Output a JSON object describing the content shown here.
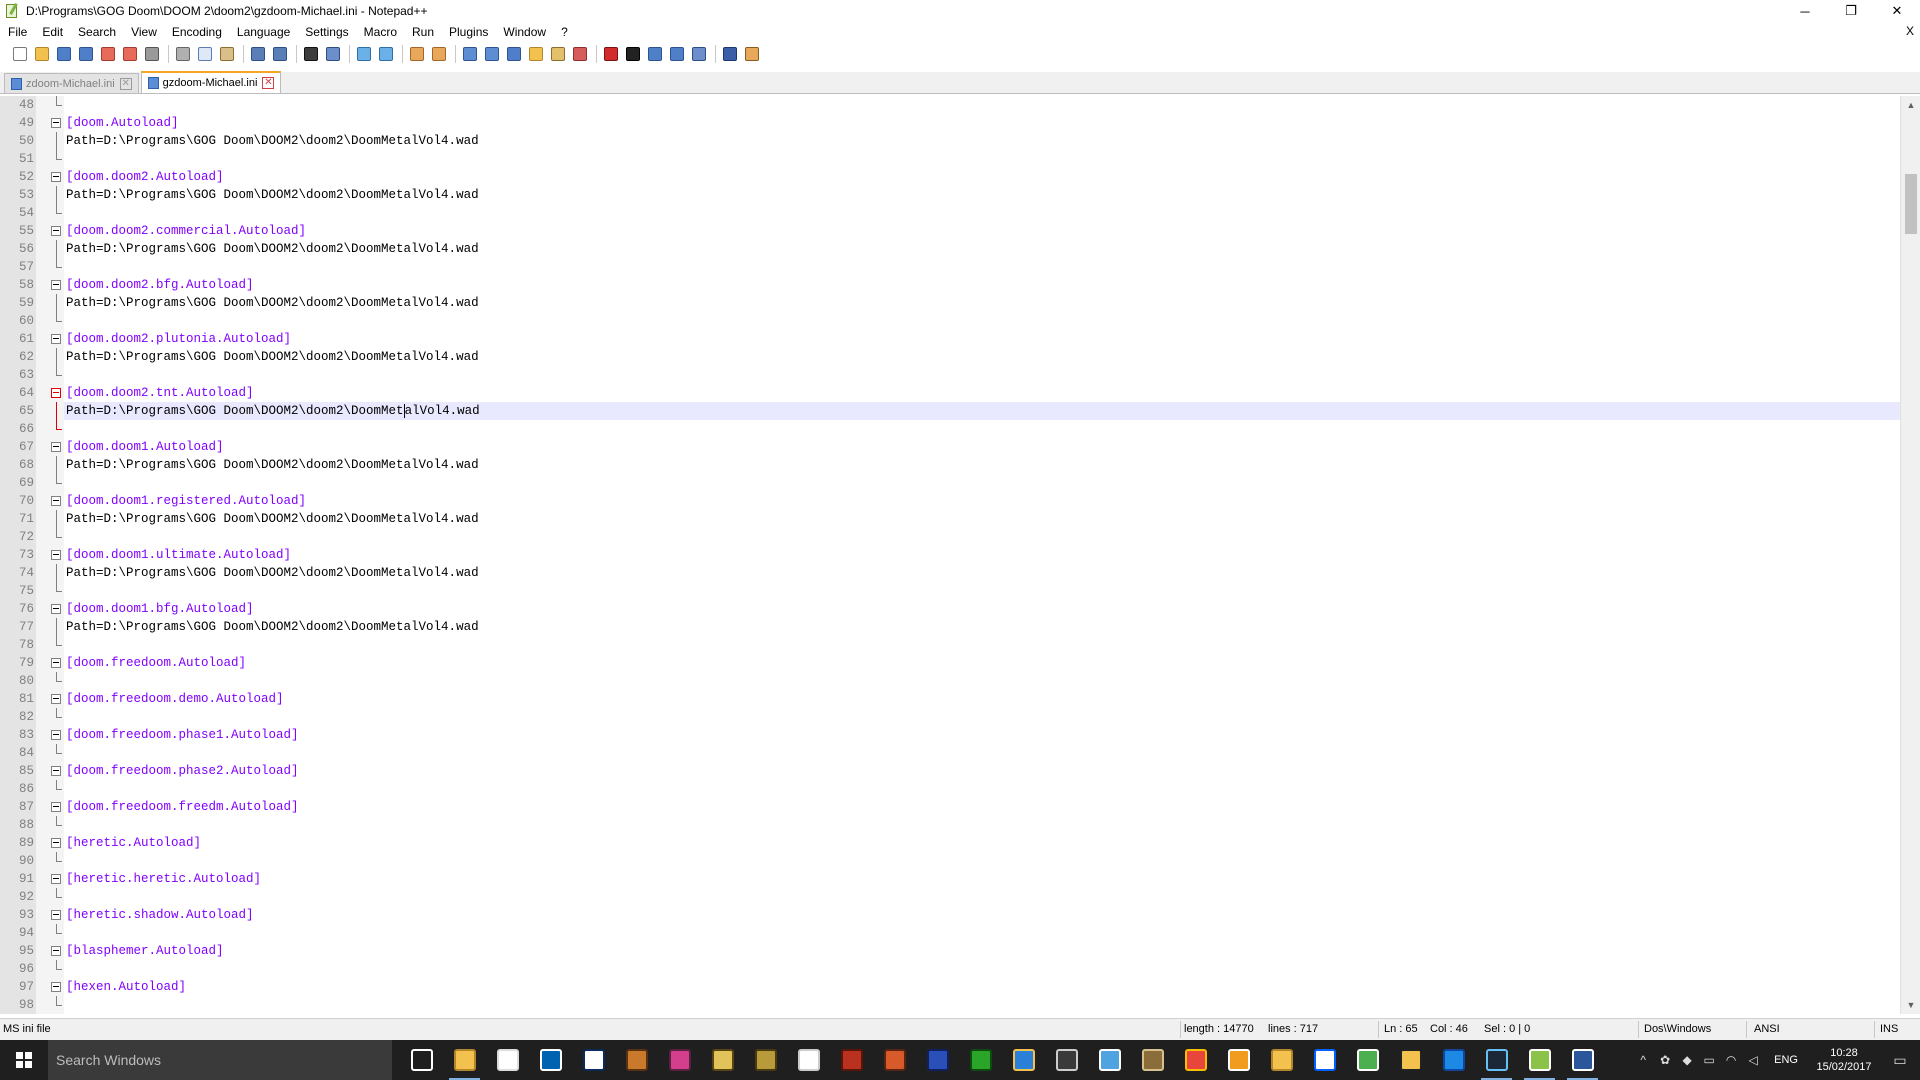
{
  "window": {
    "title": "D:\\Programs\\GOG Doom\\DOOM 2\\doom2\\gzdoom-Michael.ini - Notepad++",
    "minimize_glyph": "─",
    "restore_glyph": "❐",
    "close_glyph": "✕"
  },
  "menu": {
    "items": [
      "File",
      "Edit",
      "Search",
      "View",
      "Encoding",
      "Language",
      "Settings",
      "Macro",
      "Run",
      "Plugins",
      "Window",
      "?"
    ],
    "doc_close": "X"
  },
  "toolbar": {
    "icons": [
      {
        "name": "new-file-icon",
        "color": "#ffffff",
        "border": "#7a7a7a"
      },
      {
        "name": "open-file-icon",
        "color": "#f2c14e",
        "border": "#b3862a"
      },
      {
        "name": "save-icon",
        "color": "#4f7fc9",
        "border": "#2d5491"
      },
      {
        "name": "save-all-icon",
        "color": "#4f7fc9",
        "border": "#2d5491"
      },
      {
        "name": "close-icon",
        "color": "#e86a5a",
        "border": "#a33c2f"
      },
      {
        "name": "close-all-icon",
        "color": "#e86a5a",
        "border": "#a33c2f"
      },
      {
        "name": "print-icon",
        "color": "#9a9a9a",
        "border": "#555555"
      },
      {
        "sep": true
      },
      {
        "name": "cut-icon",
        "color": "#b0b0b0",
        "border": "#666666"
      },
      {
        "name": "copy-icon",
        "color": "#dfe8f5",
        "border": "#5c7db3"
      },
      {
        "name": "paste-icon",
        "color": "#d9c08a",
        "border": "#8c6d2f"
      },
      {
        "sep": true
      },
      {
        "name": "undo-icon",
        "color": "#5a7fb8",
        "border": "#2d4f86"
      },
      {
        "name": "redo-icon",
        "color": "#5a7fb8",
        "border": "#2d4f86"
      },
      {
        "sep": true
      },
      {
        "name": "find-icon",
        "color": "#3c3c3c",
        "border": "#111111"
      },
      {
        "name": "replace-icon",
        "color": "#6c8fcb",
        "border": "#2d4f86"
      },
      {
        "sep": true
      },
      {
        "name": "zoom-in-icon",
        "color": "#6bb0e6",
        "border": "#2f6ea8"
      },
      {
        "name": "zoom-out-icon",
        "color": "#6bb0e6",
        "border": "#2f6ea8"
      },
      {
        "sep": true
      },
      {
        "name": "sync-vertical-icon",
        "color": "#e7a85a",
        "border": "#a3652a"
      },
      {
        "name": "sync-horizontal-icon",
        "color": "#e7a85a",
        "border": "#a3652a"
      },
      {
        "sep": true
      },
      {
        "name": "word-wrap-icon",
        "color": "#5d8ed4",
        "border": "#2d5491"
      },
      {
        "name": "show-all-characters-icon",
        "color": "#5d8ed4",
        "border": "#2d5491"
      },
      {
        "name": "indent-guide-icon",
        "color": "#4f7fc9",
        "border": "#2d5491"
      },
      {
        "name": "document-map-icon",
        "color": "#f2c14e",
        "border": "#b3862a"
      },
      {
        "name": "function-list-icon",
        "color": "#e3c06a",
        "border": "#8c6d2f"
      },
      {
        "name": "folder-as-workspace-icon",
        "color": "#d65b5b",
        "border": "#8f2c2c"
      },
      {
        "sep": true
      },
      {
        "name": "record-macro-icon",
        "color": "#d22b2b",
        "border": "#7a1414"
      },
      {
        "name": "stop-recording-icon",
        "color": "#222222",
        "border": "#000000"
      },
      {
        "name": "playback-macro-icon",
        "color": "#4f7fc9",
        "border": "#2d5491"
      },
      {
        "name": "run-macro-multiple-icon",
        "color": "#4f7fc9",
        "border": "#2d5491"
      },
      {
        "name": "save-macro-icon",
        "color": "#6c8fcb",
        "border": "#2d4f86"
      },
      {
        "sep": true
      },
      {
        "name": "spell-check-icon",
        "color": "#3a5ea8",
        "border": "#1c3670"
      },
      {
        "name": "plugin-icon",
        "color": "#e7a85a",
        "border": "#8a5a1f"
      }
    ]
  },
  "tabs": [
    {
      "label": "zdoom-Michael.ini",
      "active": false
    },
    {
      "label": "gzdoom-Michael.ini",
      "active": true
    }
  ],
  "editor": {
    "current_line": 65,
    "caret_column": 46,
    "lines": [
      {
        "n": 48,
        "text": "",
        "type": "blank",
        "fold": "end"
      },
      {
        "n": 49,
        "text": "[doom.Autoload]",
        "type": "section",
        "fold": "start"
      },
      {
        "n": 50,
        "text": "Path=D:\\Programs\\GOG Doom\\DOOM2\\doom2\\DoomMetalVol4.wad",
        "type": "kv",
        "fold": "line"
      },
      {
        "n": 51,
        "text": "",
        "type": "blank",
        "fold": "end"
      },
      {
        "n": 52,
        "text": "[doom.doom2.Autoload]",
        "type": "section",
        "fold": "start"
      },
      {
        "n": 53,
        "text": "Path=D:\\Programs\\GOG Doom\\DOOM2\\doom2\\DoomMetalVol4.wad",
        "type": "kv",
        "fold": "line"
      },
      {
        "n": 54,
        "text": "",
        "type": "blank",
        "fold": "end"
      },
      {
        "n": 55,
        "text": "[doom.doom2.commercial.Autoload]",
        "type": "section",
        "fold": "start"
      },
      {
        "n": 56,
        "text": "Path=D:\\Programs\\GOG Doom\\DOOM2\\doom2\\DoomMetalVol4.wad",
        "type": "kv",
        "fold": "line"
      },
      {
        "n": 57,
        "text": "",
        "type": "blank",
        "fold": "end"
      },
      {
        "n": 58,
        "text": "[doom.doom2.bfg.Autoload]",
        "type": "section",
        "fold": "start"
      },
      {
        "n": 59,
        "text": "Path=D:\\Programs\\GOG Doom\\DOOM2\\doom2\\DoomMetalVol4.wad",
        "type": "kv",
        "fold": "line"
      },
      {
        "n": 60,
        "text": "",
        "type": "blank",
        "fold": "end"
      },
      {
        "n": 61,
        "text": "[doom.doom2.plutonia.Autoload]",
        "type": "section",
        "fold": "start"
      },
      {
        "n": 62,
        "text": "Path=D:\\Programs\\GOG Doom\\DOOM2\\doom2\\DoomMetalVol4.wad",
        "type": "kv",
        "fold": "line"
      },
      {
        "n": 63,
        "text": "",
        "type": "blank",
        "fold": "end"
      },
      {
        "n": 64,
        "text": "[doom.doom2.tnt.Autoload]",
        "type": "section",
        "fold": "start",
        "active": true
      },
      {
        "n": 65,
        "text": "Path=D:\\Programs\\GOG Doom\\DOOM2\\doom2\\DoomMetalVol4.wad",
        "type": "kv",
        "fold": "line",
        "active": true
      },
      {
        "n": 66,
        "text": "",
        "type": "blank",
        "fold": "end",
        "active": true
      },
      {
        "n": 67,
        "text": "[doom.doom1.Autoload]",
        "type": "section",
        "fold": "start"
      },
      {
        "n": 68,
        "text": "Path=D:\\Programs\\GOG Doom\\DOOM2\\doom2\\DoomMetalVol4.wad",
        "type": "kv",
        "fold": "line"
      },
      {
        "n": 69,
        "text": "",
        "type": "blank",
        "fold": "end"
      },
      {
        "n": 70,
        "text": "[doom.doom1.registered.Autoload]",
        "type": "section",
        "fold": "start"
      },
      {
        "n": 71,
        "text": "Path=D:\\Programs\\GOG Doom\\DOOM2\\doom2\\DoomMetalVol4.wad",
        "type": "kv",
        "fold": "line"
      },
      {
        "n": 72,
        "text": "",
        "type": "blank",
        "fold": "end"
      },
      {
        "n": 73,
        "text": "[doom.doom1.ultimate.Autoload]",
        "type": "section",
        "fold": "start"
      },
      {
        "n": 74,
        "text": "Path=D:\\Programs\\GOG Doom\\DOOM2\\doom2\\DoomMetalVol4.wad",
        "type": "kv",
        "fold": "line"
      },
      {
        "n": 75,
        "text": "",
        "type": "blank",
        "fold": "end"
      },
      {
        "n": 76,
        "text": "[doom.doom1.bfg.Autoload]",
        "type": "section",
        "fold": "start"
      },
      {
        "n": 77,
        "text": "Path=D:\\Programs\\GOG Doom\\DOOM2\\doom2\\DoomMetalVol4.wad",
        "type": "kv",
        "fold": "line"
      },
      {
        "n": 78,
        "text": "",
        "type": "blank",
        "fold": "end"
      },
      {
        "n": 79,
        "text": "[doom.freedoom.Autoload]",
        "type": "section",
        "fold": "start"
      },
      {
        "n": 80,
        "text": "",
        "type": "blank",
        "fold": "end"
      },
      {
        "n": 81,
        "text": "[doom.freedoom.demo.Autoload]",
        "type": "section",
        "fold": "start"
      },
      {
        "n": 82,
        "text": "",
        "type": "blank",
        "fold": "end"
      },
      {
        "n": 83,
        "text": "[doom.freedoom.phase1.Autoload]",
        "type": "section",
        "fold": "start"
      },
      {
        "n": 84,
        "text": "",
        "type": "blank",
        "fold": "end"
      },
      {
        "n": 85,
        "text": "[doom.freedoom.phase2.Autoload]",
        "type": "section",
        "fold": "start"
      },
      {
        "n": 86,
        "text": "",
        "type": "blank",
        "fold": "end"
      },
      {
        "n": 87,
        "text": "[doom.freedoom.freedm.Autoload]",
        "type": "section",
        "fold": "start"
      },
      {
        "n": 88,
        "text": "",
        "type": "blank",
        "fold": "end"
      },
      {
        "n": 89,
        "text": "[heretic.Autoload]",
        "type": "section",
        "fold": "start"
      },
      {
        "n": 90,
        "text": "",
        "type": "blank",
        "fold": "end"
      },
      {
        "n": 91,
        "text": "[heretic.heretic.Autoload]",
        "type": "section",
        "fold": "start"
      },
      {
        "n": 92,
        "text": "",
        "type": "blank",
        "fold": "end"
      },
      {
        "n": 93,
        "text": "[heretic.shadow.Autoload]",
        "type": "section",
        "fold": "start"
      },
      {
        "n": 94,
        "text": "",
        "type": "blank",
        "fold": "end"
      },
      {
        "n": 95,
        "text": "[blasphemer.Autoload]",
        "type": "section",
        "fold": "start"
      },
      {
        "n": 96,
        "text": "",
        "type": "blank",
        "fold": "end"
      },
      {
        "n": 97,
        "text": "[hexen.Autoload]",
        "type": "section",
        "fold": "start"
      },
      {
        "n": 98,
        "text": "",
        "type": "blank",
        "fold": "end"
      }
    ]
  },
  "scrollbar": {
    "up_glyph": "▲",
    "down_glyph": "▼"
  },
  "status": {
    "file_type": "MS ini file",
    "length": "length : 14770",
    "lines": "lines : 717",
    "ln": "Ln : 65",
    "col": "Col : 46",
    "sel": "Sel : 0 | 0",
    "eol": "Dos\\Windows",
    "encoding": "ANSI",
    "mode": "INS"
  },
  "taskbar": {
    "search_placeholder": "Search Windows",
    "apps": [
      {
        "name": "task-view-icon",
        "color": "#1f1f1f",
        "border": "#ffffff"
      },
      {
        "name": "file-explorer-icon",
        "color": "#f2c14e",
        "border": "#b3862a",
        "running": true
      },
      {
        "name": "store-icon",
        "color": "#ffffff",
        "border": "#dddddd"
      },
      {
        "name": "calculator-icon",
        "color": "#0063b1",
        "border": "#ffffff"
      },
      {
        "name": "terminal-icon",
        "color": "#ffffff",
        "border": "#0a2a5a"
      },
      {
        "name": "game-icon-1",
        "color": "#c9792b",
        "border": "#5a3010"
      },
      {
        "name": "game-icon-2",
        "color": "#d43f8d",
        "border": "#5a2040"
      },
      {
        "name": "game-icon-3",
        "color": "#e2c25a",
        "border": "#5a4410"
      },
      {
        "name": "game-icon-4",
        "color": "#b89a3a",
        "border": "#4a3a10"
      },
      {
        "name": "notepad-icon",
        "color": "#ffffff",
        "border": "#cccccc"
      },
      {
        "name": "game-icon-5",
        "color": "#b8321f",
        "border": "#5a1408"
      },
      {
        "name": "game-icon-6",
        "color": "#d85a2a",
        "border": "#5a2410"
      },
      {
        "name": "game-icon-7",
        "color": "#2a4fb8",
        "border": "#10205a"
      },
      {
        "name": "xbox-icon",
        "color": "#2aa52a",
        "border": "#0e4a0e"
      },
      {
        "name": "uplay-icon",
        "color": "#2a7fd8",
        "border": "#f2c14e"
      },
      {
        "name": "origin-icon",
        "color": "#3a3a3a",
        "border": "#cccccc"
      },
      {
        "name": "remote-desktop-icon",
        "color": "#4fa3e0",
        "border": "#ffffff"
      },
      {
        "name": "gog-galaxy-icon",
        "color": "#8a6d3a",
        "border": "#d8c08a"
      },
      {
        "name": "chrome-icon",
        "color": "#e8453c",
        "border": "#fbbc05"
      },
      {
        "name": "outlook-icon",
        "color": "#f29c1f",
        "border": "#ffffff"
      },
      {
        "name": "sticky-notes-icon",
        "color": "#f2c14e",
        "border": "#b3862a"
      },
      {
        "name": "dropbox-icon",
        "color": "#ffffff",
        "border": "#0061fe"
      },
      {
        "name": "green-app-icon",
        "color": "#4caf50",
        "border": "#ffffff"
      },
      {
        "name": "norton-icon",
        "color": "#f2c14e",
        "border": "#222222"
      },
      {
        "name": "edge-icon",
        "color": "#1e88e5",
        "border": "#0d47a1"
      },
      {
        "name": "steam-icon",
        "color": "#1b2838",
        "border": "#66c0f4",
        "running": true
      },
      {
        "name": "notepad-plus-plus-icon",
        "color": "#8bc34a",
        "border": "#ffffff",
        "running": true
      },
      {
        "name": "word-icon",
        "color": "#2b579a",
        "border": "#ffffff",
        "running": true
      }
    ],
    "tray": {
      "chevron": "^",
      "language": "ENG",
      "time": "10:28",
      "date": "15/02/2017",
      "notification_glyph": "▭"
    }
  }
}
